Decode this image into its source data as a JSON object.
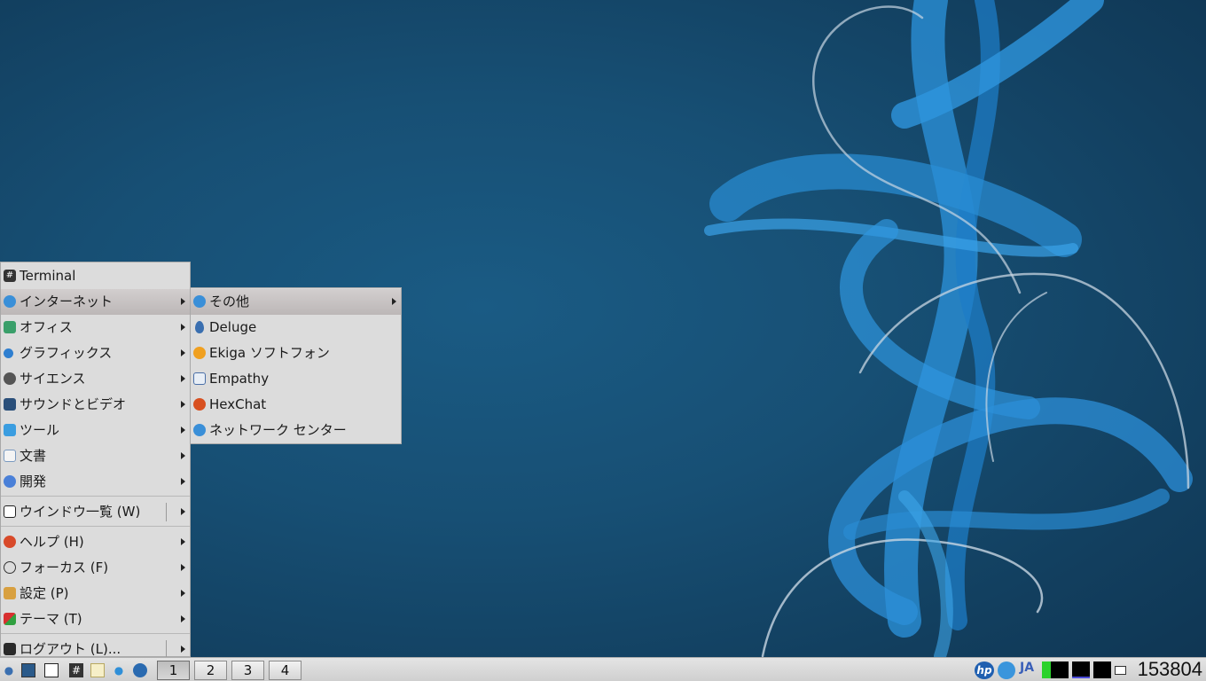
{
  "main_menu": {
    "items": [
      {
        "label": "Terminal",
        "icon": "terminal-icon"
      },
      {
        "label": "インターネット",
        "icon": "internet-icon"
      },
      {
        "label": "オフィス",
        "icon": "office-icon"
      },
      {
        "label": "グラフィックス",
        "icon": "graphics-icon"
      },
      {
        "label": "サイエンス",
        "icon": "science-icon"
      },
      {
        "label": "サウンドとビデオ",
        "icon": "sound-video-icon"
      },
      {
        "label": "ツール",
        "icon": "tools-icon"
      },
      {
        "label": "文書",
        "icon": "documents-icon"
      },
      {
        "label": "開発",
        "icon": "development-icon"
      },
      {
        "label": "ウインドウ一覧 (W)",
        "icon": "window-list-icon"
      },
      {
        "label": "ヘルプ (H)",
        "icon": "help-icon"
      },
      {
        "label": "フォーカス (F)",
        "icon": "focus-icon"
      },
      {
        "label": "設定 (P)",
        "icon": "settings-icon"
      },
      {
        "label": "テーマ (T)",
        "icon": "theme-icon"
      },
      {
        "label": "ログアウト (L)...",
        "icon": "logout-icon"
      }
    ]
  },
  "internet_submenu": {
    "items": [
      {
        "label": "その他",
        "icon": "other-icon"
      },
      {
        "label": "Deluge",
        "icon": "deluge-icon"
      },
      {
        "label": "Ekiga ソフトフォン",
        "icon": "ekiga-icon"
      },
      {
        "label": "Empathy",
        "icon": "empathy-icon"
      },
      {
        "label": "HexChat",
        "icon": "hexchat-icon"
      },
      {
        "label": "ネットワーク センター",
        "icon": "network-center-icon"
      }
    ]
  },
  "taskbar": {
    "workspaces": [
      "1",
      "2",
      "3",
      "4"
    ],
    "active_workspace": "1",
    "ime": "JA",
    "clock": "153804",
    "launchers": [
      "drop-icon",
      "desktop-icon",
      "windows-icon",
      "terminal-icon",
      "notes-icon",
      "network-icon",
      "browser-icon"
    ],
    "tray_icons": [
      "hp-icon",
      "network-tray-icon",
      "cpu-meter-icon",
      "memory-meter-icon",
      "net-meter-icon",
      "disk-meter-icon",
      "mail-icon"
    ]
  },
  "colors": {
    "desktop_bg": "#174f74",
    "menu_bg": "#dcdcdc",
    "active_item": "#c4c0c0",
    "accent_blue": "#2f8fd8",
    "meter_green": "#2cd22c"
  }
}
